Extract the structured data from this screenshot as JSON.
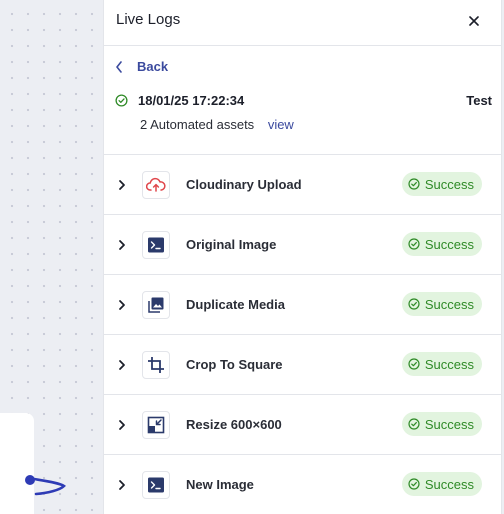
{
  "panel": {
    "title": "Live Logs"
  },
  "info": {
    "back_label": "Back",
    "timestamp": "18/01/25 17:22:34",
    "environment": "Test",
    "assets_text": "2 Automated assets",
    "view_link": "view"
  },
  "steps": [
    {
      "name": "Cloudinary Upload",
      "icon": "cloud-upload-icon",
      "status": "Success"
    },
    {
      "name": "Original Image",
      "icon": "terminal-icon",
      "status": "Success"
    },
    {
      "name": "Duplicate Media",
      "icon": "images-icon",
      "status": "Success"
    },
    {
      "name": "Crop To Square",
      "icon": "crop-icon",
      "status": "Success"
    },
    {
      "name": "Resize 600×600",
      "icon": "resize-icon",
      "status": "Success"
    },
    {
      "name": "New Image",
      "icon": "terminal-icon",
      "status": "Success"
    }
  ],
  "colors": {
    "accent": "#3b4a9e",
    "success_bg": "#e2f4df",
    "success_text": "#2f8a27",
    "upload_red": "#e0474c",
    "icon_navy": "#2b3a6b"
  }
}
